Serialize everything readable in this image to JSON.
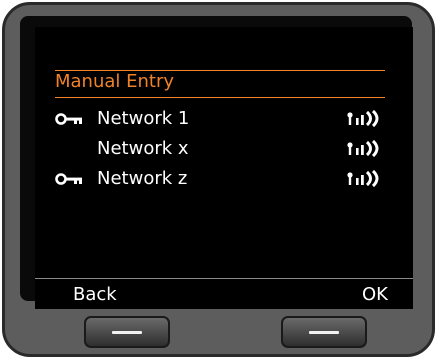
{
  "menu": {
    "title": "Manual Entry",
    "networks": [
      {
        "label": "Network 1",
        "secured": true,
        "icon": "key-icon",
        "signal_icon": "signal-strength-icon"
      },
      {
        "label": "Network x",
        "secured": false,
        "icon": "",
        "signal_icon": "signal-strength-icon"
      },
      {
        "label": "Network z",
        "secured": true,
        "icon": "key-icon",
        "signal_icon": "signal-strength-icon"
      }
    ]
  },
  "softkeys": {
    "left": "Back",
    "right": "OK"
  },
  "colors": {
    "accent": "#f0822a",
    "screen_bg": "#000000",
    "text": "#ffffff",
    "device_body": "#5d5d5d"
  }
}
